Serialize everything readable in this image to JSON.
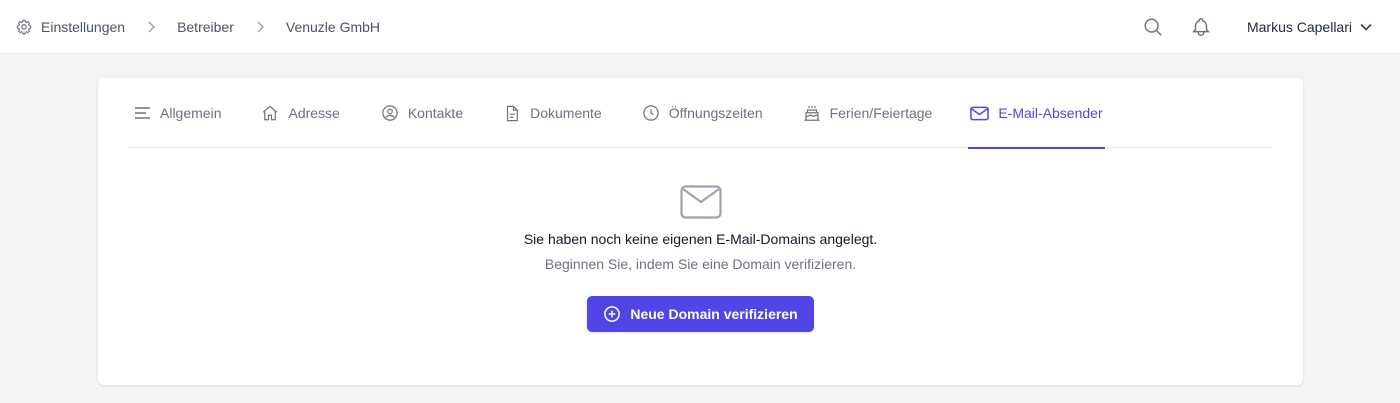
{
  "breadcrumb": {
    "items": [
      {
        "label": "Einstellungen",
        "icon": "gear-icon"
      },
      {
        "label": "Betreiber"
      },
      {
        "label": "Venuzle GmbH"
      }
    ]
  },
  "header": {
    "user_name": "Markus Capellari",
    "icons": [
      "search-icon",
      "bell-icon",
      "chevron-down-icon"
    ]
  },
  "tabs": [
    {
      "label": "Allgemein",
      "icon": "menu-lines-icon"
    },
    {
      "label": "Adresse",
      "icon": "home-icon"
    },
    {
      "label": "Kontakte",
      "icon": "user-circle-icon"
    },
    {
      "label": "Dokumente",
      "icon": "document-icon"
    },
    {
      "label": "Öffnungszeiten",
      "icon": "clock-icon"
    },
    {
      "label": "Ferien/Feiertage",
      "icon": "cake-icon"
    },
    {
      "label": "E-Mail-Absender",
      "icon": "mail-icon",
      "active": true
    }
  ],
  "empty_state": {
    "icon": "mail-icon",
    "title": "Sie haben noch keine eigenen E-Mail-Domains angelegt.",
    "subtitle": "Beginnen Sie, indem Sie eine Domain verifizieren.",
    "button_label": "Neue Domain verifizieren",
    "button_icon": "plus-circle-icon"
  },
  "colors": {
    "accent": "#4f46e5",
    "background": "#f3f4f6",
    "card": "#ffffff",
    "muted_text": "#6b7280"
  }
}
